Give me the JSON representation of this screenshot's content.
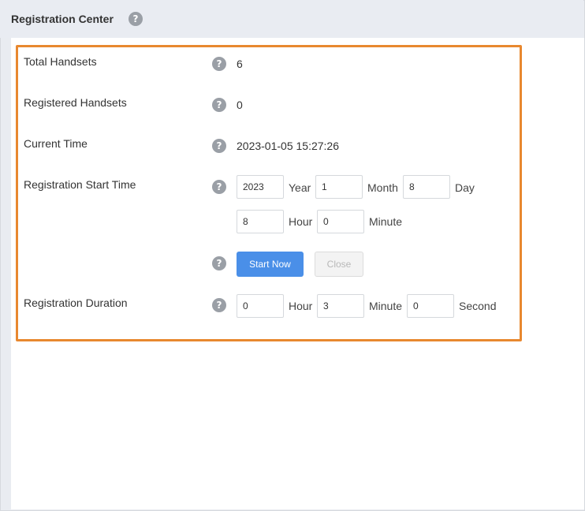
{
  "header": {
    "title": "Registration Center"
  },
  "rows": {
    "total_handsets": {
      "label": "Total Handsets",
      "value": "6"
    },
    "registered_handsets": {
      "label": "Registered Handsets",
      "value": "0"
    },
    "current_time": {
      "label": "Current Time",
      "value": "2023-01-05 15:27:26"
    },
    "start_time": {
      "label": "Registration Start Time",
      "year": "2023",
      "year_unit": "Year",
      "month": "1",
      "month_unit": "Month",
      "day": "8",
      "day_unit": "Day",
      "hour": "8",
      "hour_unit": "Hour",
      "minute": "0",
      "minute_unit": "Minute"
    },
    "actions": {
      "start_label": "Start Now",
      "close_label": "Close"
    },
    "duration": {
      "label": "Registration Duration",
      "hour": "0",
      "hour_unit": "Hour",
      "minute": "3",
      "minute_unit": "Minute",
      "second": "0",
      "second_unit": "Second"
    }
  },
  "help_glyph": "?",
  "colors": {
    "highlight": "#e8882f",
    "primary": "#4a8fe8",
    "help": "#9a9fa6"
  }
}
